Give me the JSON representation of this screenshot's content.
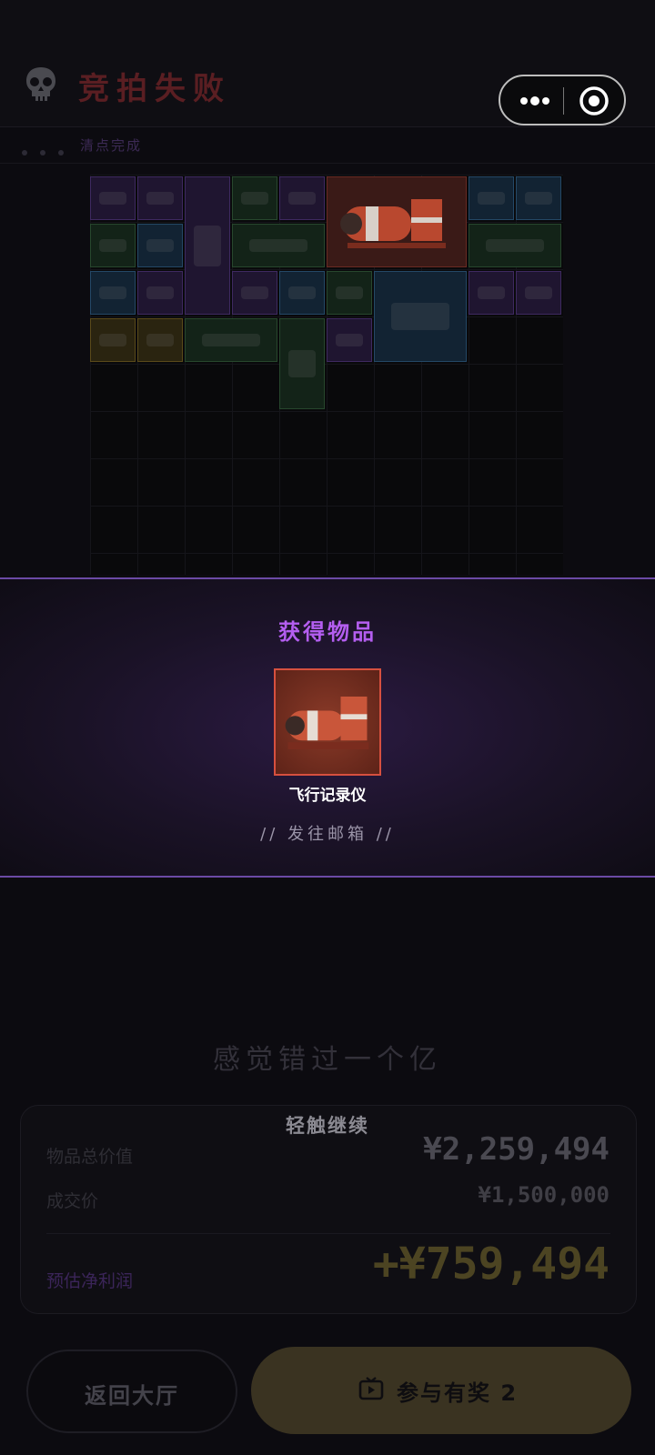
{
  "header": {
    "title": "竞拍失败",
    "skull_icon": "skull-icon",
    "more_icon": "more-dots-icon",
    "target_icon": "target-icon",
    "status_text": "清点完成"
  },
  "inventory": {
    "qualities": {
      "purple": "#3e2960",
      "blue": "#244866",
      "green": "#27472d",
      "gold": "#5a4a1a",
      "red": "#6a2a22"
    },
    "items": [
      {
        "quality": "purple",
        "icon": "bar-icon"
      },
      {
        "quality": "purple",
        "icon": "dagger-icon"
      },
      {
        "quality": "purple",
        "icon": "lantern-icon"
      },
      {
        "quality": "green",
        "icon": "notebook-icon"
      },
      {
        "quality": "purple",
        "icon": "orb-icon"
      },
      {
        "quality": "red",
        "icon": "flight-recorder-icon"
      },
      {
        "quality": "blue",
        "icon": "disc-icon"
      },
      {
        "quality": "blue",
        "icon": "blade-icon"
      },
      {
        "quality": "green",
        "icon": "wrench-icon"
      },
      {
        "quality": "blue",
        "icon": "thermometer-gun-icon"
      },
      {
        "quality": "green",
        "icon": "paper-icon"
      },
      {
        "quality": "green",
        "icon": "tube-icon"
      },
      {
        "quality": "blue",
        "icon": "shovel-icon"
      },
      {
        "quality": "purple",
        "icon": "bracelet-icon"
      },
      {
        "quality": "purple",
        "icon": "rod-icon"
      },
      {
        "quality": "blue",
        "icon": "thermometer-gun-icon"
      },
      {
        "quality": "green",
        "icon": "scroll-icon"
      },
      {
        "quality": "blue",
        "icon": "drone-icon"
      },
      {
        "quality": "purple",
        "icon": "teacup-icon"
      },
      {
        "quality": "purple",
        "icon": "radio-icon"
      },
      {
        "quality": "gold",
        "icon": "battery-icon"
      },
      {
        "quality": "gold",
        "icon": "rack-icon"
      },
      {
        "quality": "green",
        "icon": "document-icon"
      },
      {
        "quality": "green",
        "icon": "spray-can-icon"
      },
      {
        "quality": "purple",
        "icon": "feather-icon"
      }
    ]
  },
  "reward": {
    "title": "获得物品",
    "item_name": "飞行记录仪",
    "item_icon": "flight-recorder-icon",
    "hint": "// 发往邮箱 //"
  },
  "summary": {
    "quote": "感觉错过一个亿",
    "tap_hint": "轻触继续",
    "total_label": "物品总价值",
    "total_value": "¥2,259,494",
    "deal_label": "成交价",
    "deal_value": "¥1,500,000",
    "profit_label": "预估净利润",
    "profit_value": "+¥759,494"
  },
  "buttons": {
    "back": "返回大厅",
    "join": "参与有奖 2",
    "join_icon": "tv-icon"
  }
}
